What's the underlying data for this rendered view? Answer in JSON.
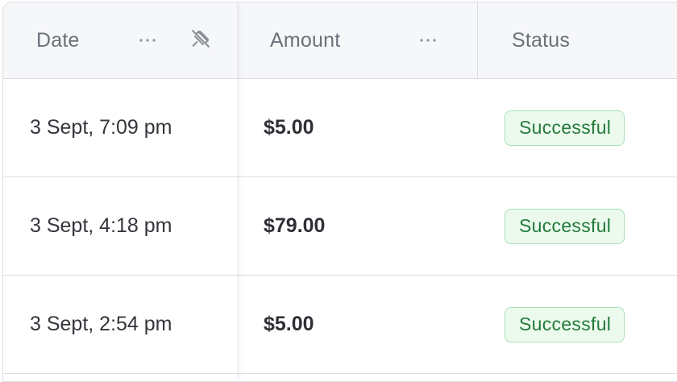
{
  "columns": {
    "date": "Date",
    "amount": "Amount",
    "status": "Status"
  },
  "rows": [
    {
      "date": "3 Sept, 7:09 pm",
      "amount": "$5.00",
      "status": "Successful"
    },
    {
      "date": "3 Sept, 4:18 pm",
      "amount": "$79.00",
      "status": "Successful"
    },
    {
      "date": "3 Sept, 2:54 pm",
      "amount": "$5.00",
      "status": "Successful"
    }
  ],
  "icons": {
    "column_menu": "more-horizontal-icon",
    "pin": "unpin-icon"
  },
  "colors": {
    "header_bg": "#f6f7f9",
    "border": "#dcdee3",
    "success_bg": "#ecfaee",
    "success_border": "#a8e0b6",
    "success_text": "#237a3a"
  }
}
